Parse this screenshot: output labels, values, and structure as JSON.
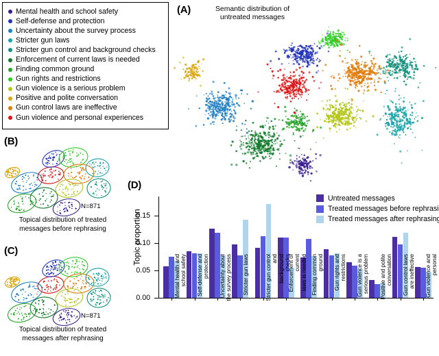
{
  "legend": {
    "topics": [
      {
        "label": "Mental health and school safety",
        "color": "#3b1f8f"
      },
      {
        "label": "Self-defense and protection",
        "color": "#2233bb"
      },
      {
        "label": "Uncertainty about the survey process",
        "color": "#1f7fc4"
      },
      {
        "label": "Stricter gun laws",
        "color": "#1aa3a8"
      },
      {
        "label": "Stricter gun control and background checks",
        "color": "#13917e"
      },
      {
        "label": "Enforcement of current laws is needed",
        "color": "#127a2a"
      },
      {
        "label": "Finding common ground",
        "color": "#27a328"
      },
      {
        "label": "Gun rights and restrictions",
        "color": "#2ecc25"
      },
      {
        "label": "Gun violence is a serious problem",
        "color": "#b3c619"
      },
      {
        "label": "Positive and polite conversation",
        "color": "#d9a509"
      },
      {
        "label": "Gun control laws are ineffective",
        "color": "#e07b0a"
      },
      {
        "label": "Gun violence and personal experiences",
        "color": "#dc1414"
      }
    ]
  },
  "panelA": {
    "letter": "(A)",
    "title": "Semantic distribution of\nuntreated messages"
  },
  "panelB": {
    "letter": "(B)",
    "n_label": "N=871",
    "caption": "Topical distribution of treated\nmessages before rephrasing"
  },
  "panelC": {
    "letter": "(C)",
    "n_label": "N=871",
    "caption": "Topical distribution of treated\nmessages after rephrasing"
  },
  "panelD": {
    "letter": "(D)"
  },
  "chart_data": {
    "type": "bar",
    "title": "",
    "xlabel": "",
    "ylabel": "Topic proportion",
    "ylim": [
      0,
      0.185
    ],
    "yticks": [
      0.0,
      0.05,
      0.1,
      0.15
    ],
    "ytick_labels": [
      "0.00",
      "0.05",
      "0.10",
      "0.15"
    ],
    "grid": false,
    "legend_position": "top-right",
    "categories": [
      "Mental health and\nschool safety",
      "Self-defense and\nprotection",
      "Uncertainty about\nthe survey process",
      "Stricter gun laws",
      "Stricter gun control and\nbackground checks",
      "Enforcement of current\nlaws is needed",
      "Finding common\nground",
      "Gun rights and\nrestrictions",
      "Gun violence is a\nserious problem",
      "Positive and polite\nconversation",
      "Gun control laws\nare ineffective",
      "Gun violence and\npersonal experiences"
    ],
    "series": [
      {
        "name": "Untreated messages",
        "color": "#4b2ea0",
        "values": [
          0.058,
          0.085,
          0.126,
          0.097,
          0.091,
          0.11,
          0.074,
          0.089,
          0.065,
          0.033,
          0.111,
          0.056
        ]
      },
      {
        "name": "Treated messages before rephrasing",
        "color": "#5a5ce0",
        "values": [
          0.075,
          0.081,
          0.119,
          0.078,
          0.112,
          0.11,
          0.107,
          0.078,
          0.059,
          0.025,
          0.098,
          0.055
        ]
      },
      {
        "name": "Treated messages after rephrasing",
        "color": "#aed4ee",
        "values": [
          0.068,
          0.081,
          0.078,
          0.143,
          0.171,
          0.055,
          0.076,
          0.081,
          0.053,
          0.027,
          0.119,
          0.047
        ]
      }
    ]
  }
}
